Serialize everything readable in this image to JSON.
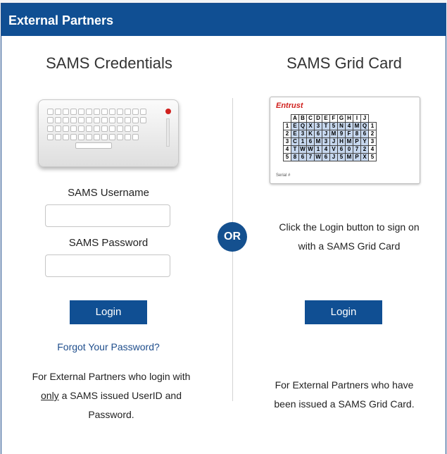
{
  "header": {
    "title": "External Partners"
  },
  "left": {
    "title": "SAMS Credentials",
    "username_label": "SAMS Username",
    "username_value": "",
    "password_label": "SAMS Password",
    "password_value": "",
    "login_label": "Login",
    "forgot_link": "Forgot Your Password?",
    "desc_part1": "For External Partners who login with ",
    "desc_emphasis": "only",
    "desc_part2": " a SAMS issued UserID and Password."
  },
  "or_badge": "OR",
  "right": {
    "title": "SAMS Grid Card",
    "instruction": "Click the Login button to sign on with a SAMS Grid Card",
    "login_label": "Login",
    "desc": "For External Partners who have been issued a SAMS Grid Card."
  },
  "grid_card": {
    "brand": "Entrust",
    "columns": [
      "A",
      "B",
      "C",
      "D",
      "E",
      "F",
      "G",
      "H",
      "I",
      "J"
    ],
    "rows": [
      {
        "label": "1",
        "cells": [
          "E",
          "Q",
          "X",
          "3",
          "T",
          "5",
          "N",
          "4",
          "M",
          "Q"
        ],
        "end": "1"
      },
      {
        "label": "2",
        "cells": [
          "E",
          "3",
          "K",
          "6",
          "J",
          "M",
          "9",
          "F",
          "8",
          "6"
        ],
        "end": "2"
      },
      {
        "label": "3",
        "cells": [
          "C",
          "1",
          "6",
          "M",
          "3",
          "J",
          "H",
          "M",
          "P",
          "Y"
        ],
        "end": "3"
      },
      {
        "label": "4",
        "cells": [
          "T",
          "W",
          "W",
          "1",
          "4",
          "V",
          "6",
          "0",
          "7",
          "2"
        ],
        "end": "4"
      },
      {
        "label": "5",
        "cells": [
          "8",
          "6",
          "7",
          "W",
          "6",
          "J",
          "5",
          "M",
          "P",
          "X"
        ],
        "end": "5"
      }
    ],
    "serial_label": "Serial #"
  },
  "colors": {
    "header_bg": "#104f93",
    "button_bg": "#104f93",
    "link": "#1f4e8c",
    "grid_cell": "#c6d7ee"
  },
  "icons": [
    "keyboard-image",
    "grid-card-image"
  ]
}
